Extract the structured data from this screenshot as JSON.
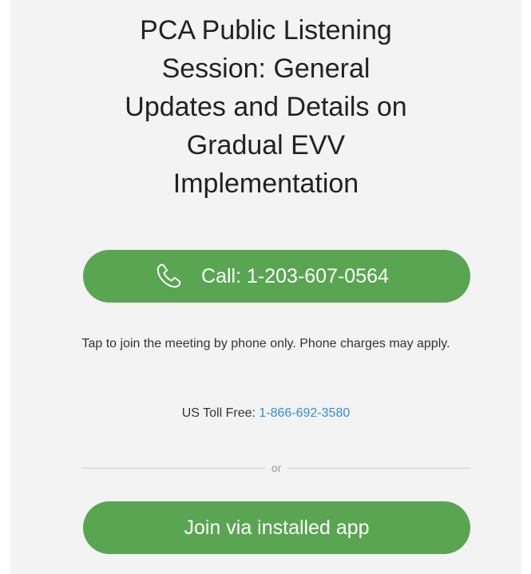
{
  "meeting": {
    "title_lines": [
      "PCA Public Listening",
      "Session: General",
      "Updates and Details on",
      "Gradual EVV",
      "Implementation"
    ]
  },
  "call_button": {
    "label": "Call: 1-203-607-0564",
    "icon": "phone-icon",
    "color": "#5aa552"
  },
  "phone_hint": "Tap to join the meeting by phone only. Phone charges may apply.",
  "toll_free": {
    "label": "US Toll Free: ",
    "number": "1-866-692-3580",
    "link_color": "#2f8ee0"
  },
  "divider": {
    "text": "or"
  },
  "app_button": {
    "label": "Join via installed app",
    "color": "#5aa552"
  }
}
